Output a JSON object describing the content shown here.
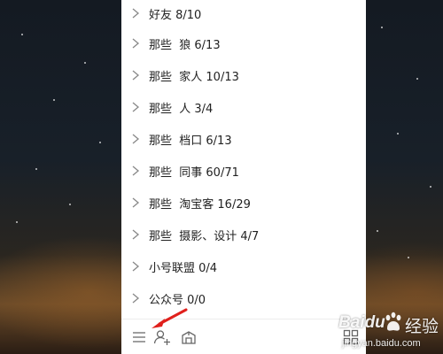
{
  "groups": [
    {
      "label": "好友 8/10"
    },
    {
      "label": "那些  狼 6/13"
    },
    {
      "label": "那些  家人 10/13"
    },
    {
      "label": "那些  人 3/4"
    },
    {
      "label": "那些  档口 6/13"
    },
    {
      "label": "那些  同事 60/71"
    },
    {
      "label": "那些  淘宝客 16/29"
    },
    {
      "label": "那些  摄影、设计 4/7"
    },
    {
      "label": "小号联盟 0/4"
    },
    {
      "label": "公众号 0/0"
    }
  ],
  "bottom_bar": {
    "icons": [
      "menu-icon",
      "add-contact-icon",
      "apps-icon",
      "grid-icon"
    ]
  },
  "watermark": {
    "brand": "Baidu",
    "site": "jingyan.baidu.com",
    "text": "经验"
  },
  "colors": {
    "annotation_arrow": "#e0201c",
    "panel": "#ffffff",
    "text": "#222222",
    "chevron": "#888888"
  }
}
